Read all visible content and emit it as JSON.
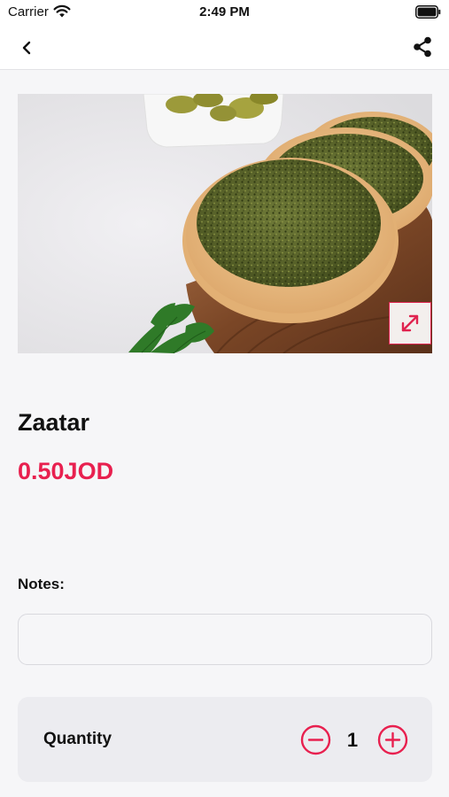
{
  "status_bar": {
    "carrier": "Carrier",
    "time": "2:49 PM"
  },
  "nav": {
    "back_icon": "chevron-left-icon",
    "share_icon": "share-icon"
  },
  "product": {
    "image_alt": "Zaatar manakeesh on wooden board",
    "name": "Zaatar",
    "price": "0.50JOD",
    "expand_icon": "expand-icon"
  },
  "notes": {
    "label": "Notes:",
    "value": "",
    "placeholder": ""
  },
  "quantity": {
    "label": "Quantity",
    "value": "1",
    "minus_icon": "minus-circle-icon",
    "plus_icon": "plus-circle-icon"
  },
  "colors": {
    "accent": "#e8204f",
    "background": "#f6f6f8",
    "card": "#ececf0"
  }
}
